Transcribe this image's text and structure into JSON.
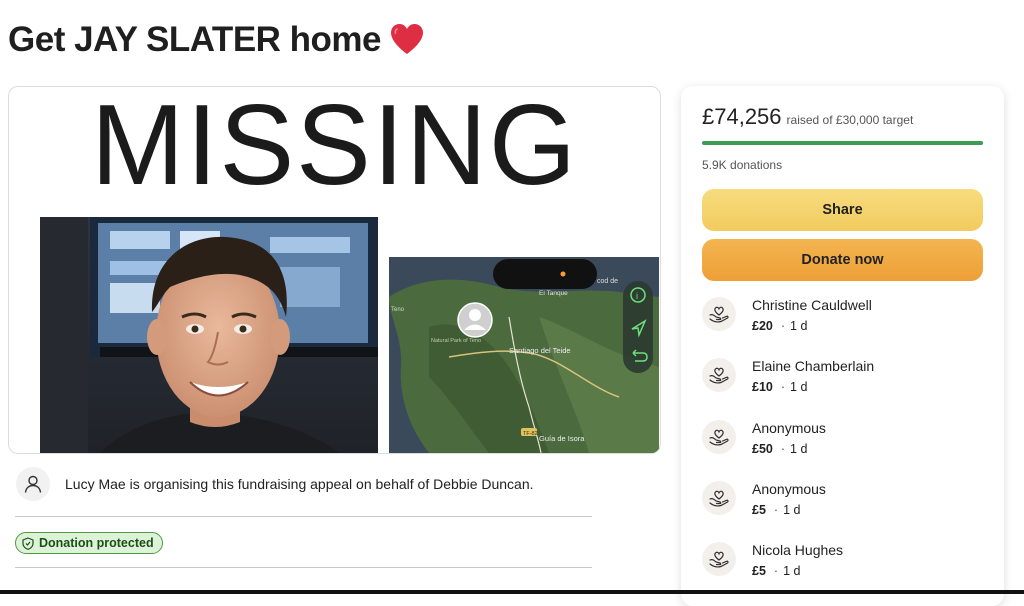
{
  "page": {
    "title": "Get JAY SLATER home",
    "title_emoji": "heart"
  },
  "hero": {
    "banner_text": "MISSING",
    "map_labels": {
      "place1": "Santiago del Teide",
      "place2": "Guía de Isora",
      "place3": "El Tanque",
      "place4": "Teno",
      "place5": "Natural Park of Teno",
      "place6": "cod de",
      "road": "TF-82"
    }
  },
  "organiser": {
    "text": "Lucy Mae is organising this fundraising appeal on behalf of Debbie Duncan."
  },
  "badge": {
    "label": "Donation protected"
  },
  "sidebar": {
    "amount": "£74,256",
    "target": "raised of £30,000 target",
    "progress_fraction": 1.0,
    "progress_color": "#3a9c55",
    "count": "5.9K donations",
    "share_label": "Share",
    "donate_label": "Donate now",
    "donations": [
      {
        "name": "Christine Cauldwell",
        "amount": "£20",
        "time": "1 d"
      },
      {
        "name": "Elaine Chamberlain",
        "amount": "£10",
        "time": "1 d"
      },
      {
        "name": "Anonymous",
        "amount": "£50",
        "time": "1 d"
      },
      {
        "name": "Anonymous",
        "amount": "£5",
        "time": "1 d"
      },
      {
        "name": "Nicola Hughes",
        "amount": "£5",
        "time": "1 d"
      }
    ]
  }
}
